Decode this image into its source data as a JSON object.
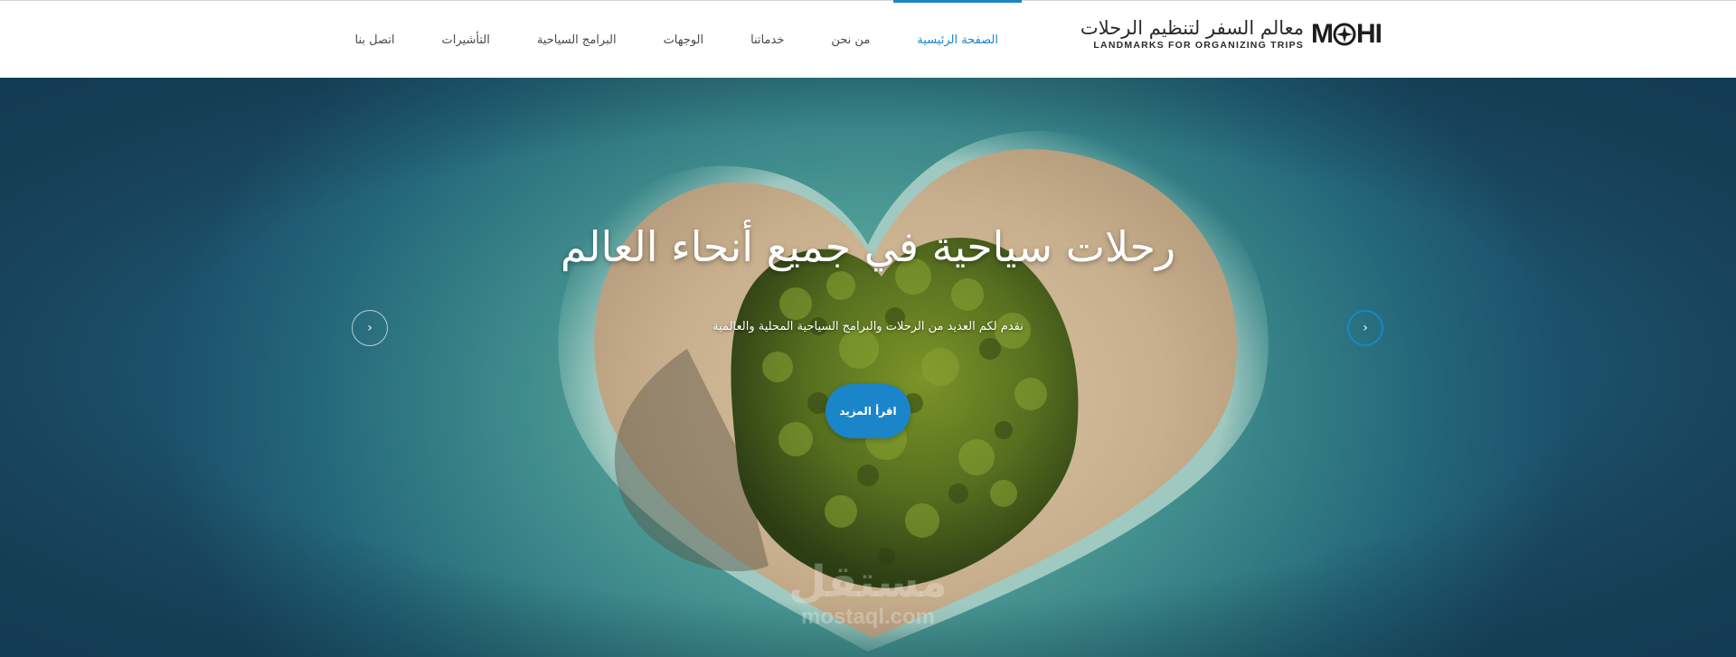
{
  "brand": {
    "mark_text": "M",
    "mark_suffix": "HI",
    "arabic_name": "معالم السفر لتنظيم الرحلات",
    "english_name": "LANDMARKS FOR ORGANIZING TRIPS"
  },
  "nav": {
    "items": [
      {
        "label": "الصفحة الرئيسية",
        "active": true
      },
      {
        "label": "من نحن",
        "active": false
      },
      {
        "label": "خدماتنا",
        "active": false
      },
      {
        "label": "الوجهات",
        "active": false
      },
      {
        "label": "البرامج السياحية",
        "active": false
      },
      {
        "label": "التأشيرات",
        "active": false
      },
      {
        "label": "اتصل بنا",
        "active": false
      }
    ]
  },
  "hero": {
    "title": "رحلات سياحية في جميع أنحاء العالم",
    "subtitle": "نقدم لكم العديد من الرحلات والبرامج السياحية المحلية والعالمية",
    "button_label": "اقرأ المزيد",
    "prev_arrow": "‹",
    "next_arrow": "›"
  },
  "watermark": {
    "arabic": "مستقل",
    "english": "mostaql.com"
  },
  "colors": {
    "accent": "#1a86c9",
    "nav_text": "#4a4a4a",
    "sea": "#4e9c96",
    "sand": "#c9b394",
    "foliage": "#4f6b1c"
  }
}
